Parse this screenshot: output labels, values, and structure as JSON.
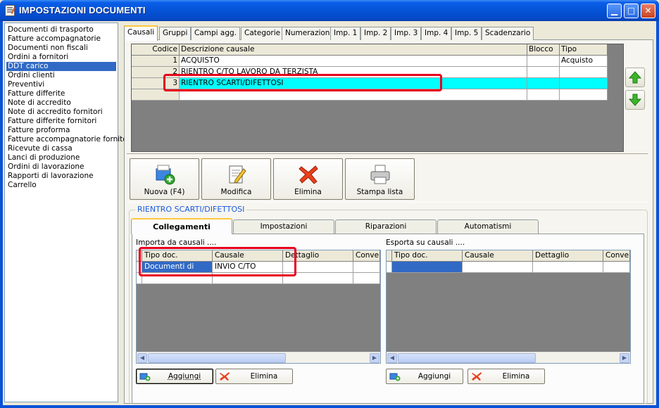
{
  "window": {
    "title": "IMPOSTAZIONI DOCUMENTI"
  },
  "doclist": {
    "items": [
      "Documenti di trasporto",
      "Fatture accompagnatorie",
      "Documenti non fiscali",
      "Ordini a fornitori",
      "DDT carico",
      "Ordini clienti",
      "Preventivi",
      "Fatture differite",
      "Note di accredito",
      "Note di accredito fornitori",
      "Fatture differite fornitori",
      "Fatture proforma",
      "Fatture accompagnatorie fornitori",
      "Ricevute di cassa",
      "Lanci di produzione",
      "Ordini di lavorazione",
      "Rapporti di lavorazione",
      "Carrello"
    ],
    "selected": "DDT carico"
  },
  "tabs": [
    "Causali",
    "Gruppi",
    "Campi agg.",
    "Categorie",
    "Numerazioni",
    "Imp. 1",
    "Imp. 2",
    "Imp. 3",
    "Imp. 4",
    "Imp. 5",
    "Scadenzario"
  ],
  "causali_grid": {
    "headers": [
      "Codice",
      "Descrizione causale",
      "Blocco",
      "Tipo"
    ],
    "rows": [
      {
        "codice": "1",
        "descrizione": "ACQUISTO",
        "blocco": "",
        "tipo": "Acquisto"
      },
      {
        "codice": "2",
        "descrizione": "RIENTRO C/TO LAVORO DA TERZISTA",
        "blocco": "",
        "tipo": ""
      },
      {
        "codice": "3",
        "descrizione": "RIENTRO SCARTI/DIFETTOSI",
        "blocco": "",
        "tipo": ""
      }
    ]
  },
  "toolbar": {
    "nuova": "Nuova (F4)",
    "modifica": "Modifica",
    "elimina": "Elimina",
    "stampa": "Stampa lista"
  },
  "group": {
    "title": "RIENTRO SCARTI/DIFETTOSI"
  },
  "subtabs": [
    "Collegamenti",
    "Impostazioni",
    "Riparazioni",
    "Automatismi"
  ],
  "importa": {
    "label": "Importa da causali ....",
    "headers": [
      "Tipo doc.",
      "Causale",
      "Dettaglio",
      "Conversi"
    ],
    "rows": [
      {
        "tipo": "Documenti di",
        "causale": "INVIO C/TO",
        "dettaglio": "",
        "conv": ""
      }
    ],
    "add": "Aggiungi",
    "del": "Elimina"
  },
  "esporta": {
    "label": "Esporta su causali ....",
    "headers": [
      "Tipo doc.",
      "Causale",
      "Dettaglio",
      "Conversi"
    ],
    "add": "Aggiungi",
    "del": "Elimina"
  },
  "colors": {
    "highlight": "#00ffff",
    "selection": "#316ac5",
    "annotation": "#e8001c"
  }
}
